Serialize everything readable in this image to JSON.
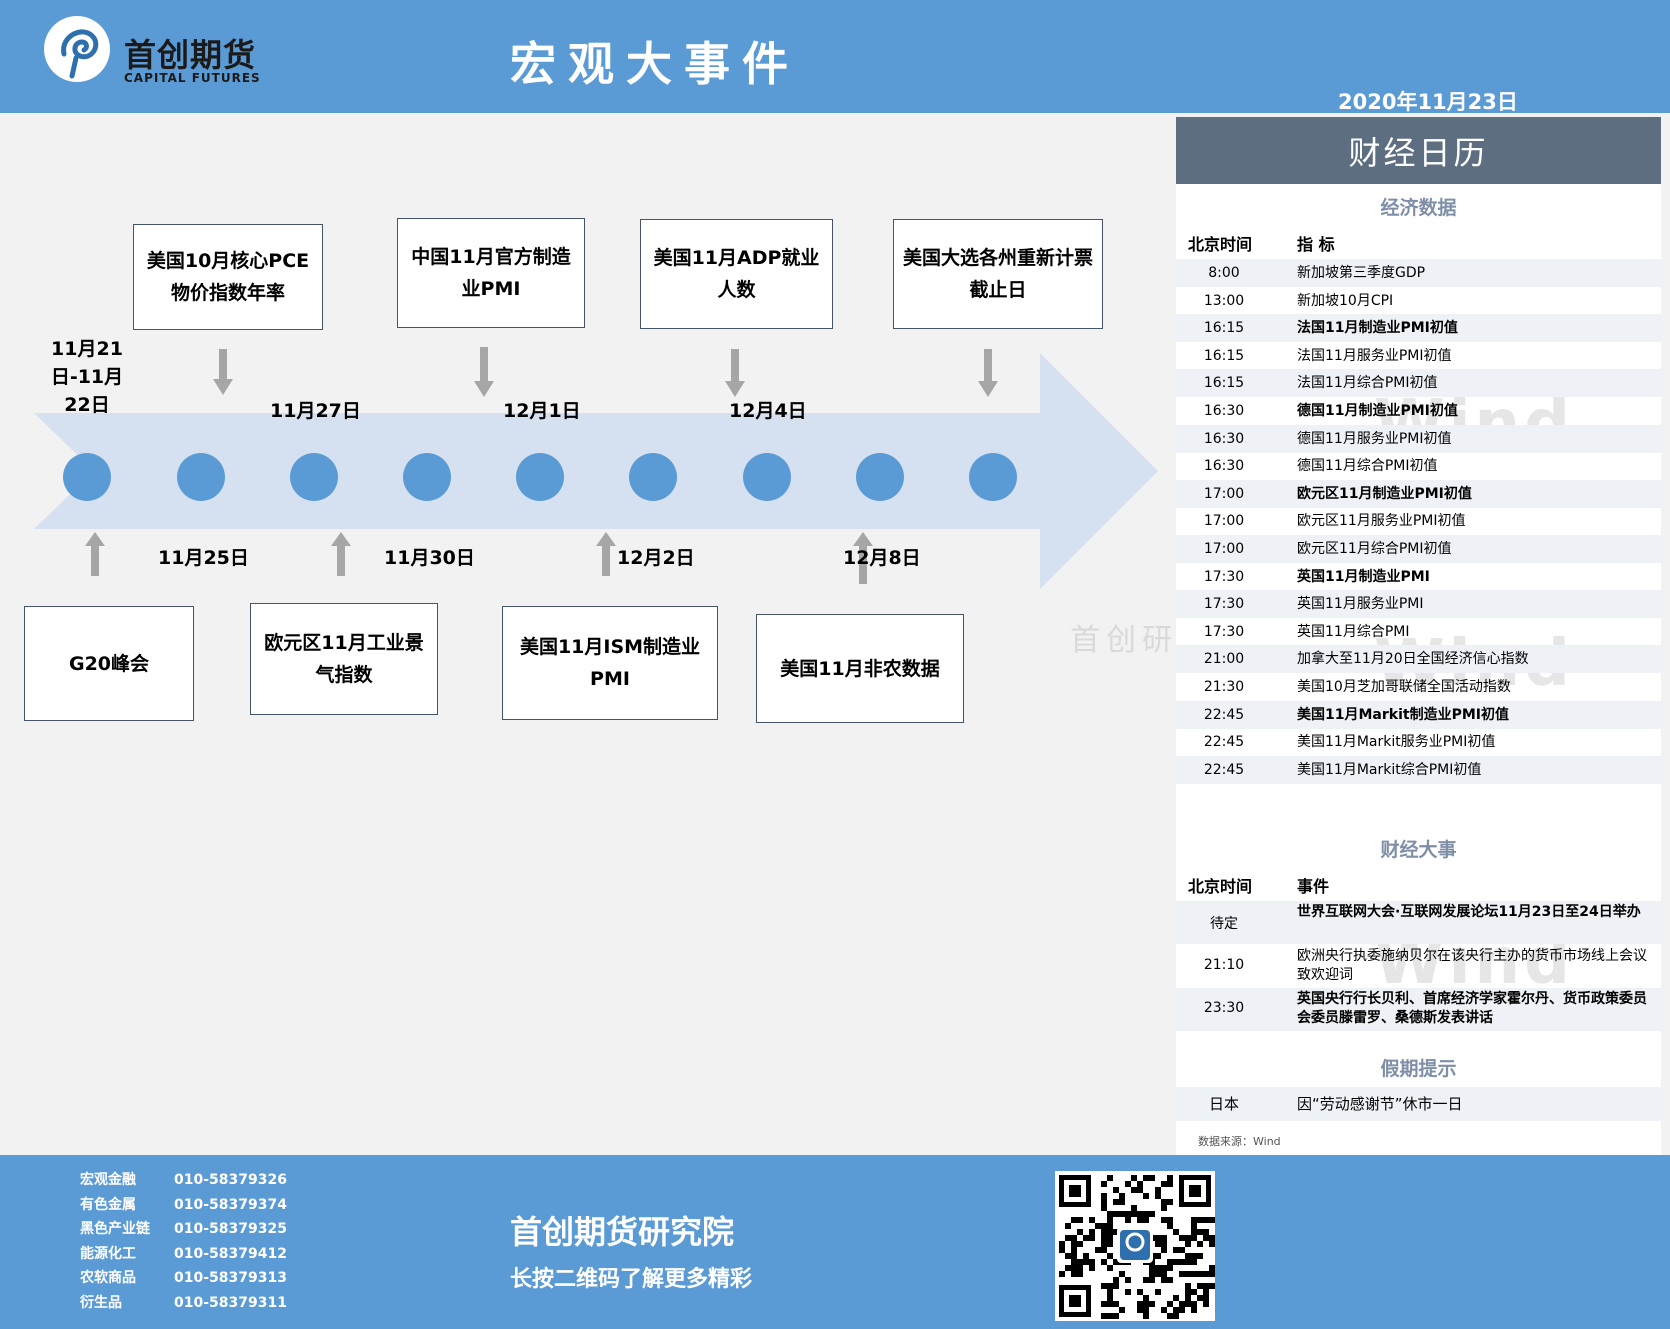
{
  "header": {
    "logo_cn": "首创期货",
    "logo_en": "CAPITAL FUTURES",
    "title": "宏观大事件",
    "date": "2020年11月23日"
  },
  "timeline": {
    "events_top": [
      {
        "text": "美国10月核心PCE物价指数年率"
      },
      {
        "text": "中国11月官方制造业PMI"
      },
      {
        "text": "美国11月ADP就业人数"
      },
      {
        "text": "美国大选各州重新计票截止日"
      }
    ],
    "events_bottom": [
      {
        "text": "G20峰会"
      },
      {
        "text": "欧元区11月工业景气指数"
      },
      {
        "text": "美国11月ISM制造业PMI"
      },
      {
        "text": "美国11月非农数据"
      }
    ],
    "dates_top": [
      "11月21日-11月22日",
      "11月27日",
      "12月1日",
      "12月4日"
    ],
    "dates_bottom": [
      "11月25日",
      "11月30日",
      "12月2日",
      "12月8日"
    ],
    "watermark": "首创研"
  },
  "calendar": {
    "title": "财经日历",
    "econ_section": "经济数据",
    "col_time": "北京时间",
    "col_indicator": "指 标",
    "econ_rows": [
      {
        "time": "8:00",
        "name": "新加坡第三季度GDP",
        "bold": false
      },
      {
        "time": "13:00",
        "name": "新加坡10月CPI",
        "bold": false
      },
      {
        "time": "16:15",
        "name": "法国11月制造业PMI初值",
        "bold": true
      },
      {
        "time": "16:15",
        "name": "法国11月服务业PMI初值",
        "bold": false
      },
      {
        "time": "16:15",
        "name": "法国11月综合PMI初值",
        "bold": false
      },
      {
        "time": "16:30",
        "name": "德国11月制造业PMI初值",
        "bold": true
      },
      {
        "time": "16:30",
        "name": "德国11月服务业PMI初值",
        "bold": false
      },
      {
        "time": "16:30",
        "name": "德国11月综合PMI初值",
        "bold": false
      },
      {
        "time": "17:00",
        "name": "欧元区11月制造业PMI初值",
        "bold": true
      },
      {
        "time": "17:00",
        "name": "欧元区11月服务业PMI初值",
        "bold": false
      },
      {
        "time": "17:00",
        "name": "欧元区11月综合PMI初值",
        "bold": false
      },
      {
        "time": "17:30",
        "name": "英国11月制造业PMI",
        "bold": true
      },
      {
        "time": "17:30",
        "name": "英国11月服务业PMI",
        "bold": false
      },
      {
        "time": "17:30",
        "name": "英国11月综合PMI",
        "bold": false
      },
      {
        "time": "21:00",
        "name": "加拿大至11月20日全国经济信心指数",
        "bold": false
      },
      {
        "time": "21:30",
        "name": "美国10月芝加哥联储全国活动指数",
        "bold": false
      },
      {
        "time": "22:45",
        "name": "美国11月Markit制造业PMI初值",
        "bold": true
      },
      {
        "time": "22:45",
        "name": "美国11月Markit服务业PMI初值",
        "bold": false
      },
      {
        "time": "22:45",
        "name": "美国11月Markit综合PMI初值",
        "bold": false
      }
    ],
    "events_section": "财经大事",
    "col_event": "事件",
    "event_rows": [
      {
        "time": "待定",
        "name": "世界互联网大会·互联网发展论坛11月23日至24日举办",
        "bold": true
      },
      {
        "time": "21:10",
        "name": "欧洲央行执委施纳贝尔在该央行主办的货币市场线上会议致欢迎词",
        "bold": false
      },
      {
        "time": "23:30",
        "name": "英国央行行长贝利、首席经济学家霍尔丹、货币政策委员会委员滕雷罗、桑德斯发表讲话",
        "bold": true
      }
    ],
    "holiday_section": "假期提示",
    "holiday_rows": [
      {
        "time": "日本",
        "name": "因“劳动感谢节”休市一日"
      }
    ],
    "source": "数据来源：Wind",
    "watermark": "Wind"
  },
  "footer": {
    "contacts": [
      {
        "category": "宏观金融",
        "phone": "010-58379326"
      },
      {
        "category": "有色金属",
        "phone": "010-58379374"
      },
      {
        "category": "黑色产业链",
        "phone": "010-58379325"
      },
      {
        "category": "能源化工",
        "phone": "010-58379412"
      },
      {
        "category": "农软商品",
        "phone": "010-58379313"
      },
      {
        "category": "衍生品",
        "phone": "010-58379311"
      }
    ],
    "title": "首创期货研究院",
    "subtitle": "长按二维码了解更多精彩"
  },
  "colors": {
    "header_bg": "#5b9bd5",
    "arrow_fill": "#d5e1f0",
    "dot_fill": "#5b9bd5",
    "calendar_title_bg": "#5d6e80"
  }
}
